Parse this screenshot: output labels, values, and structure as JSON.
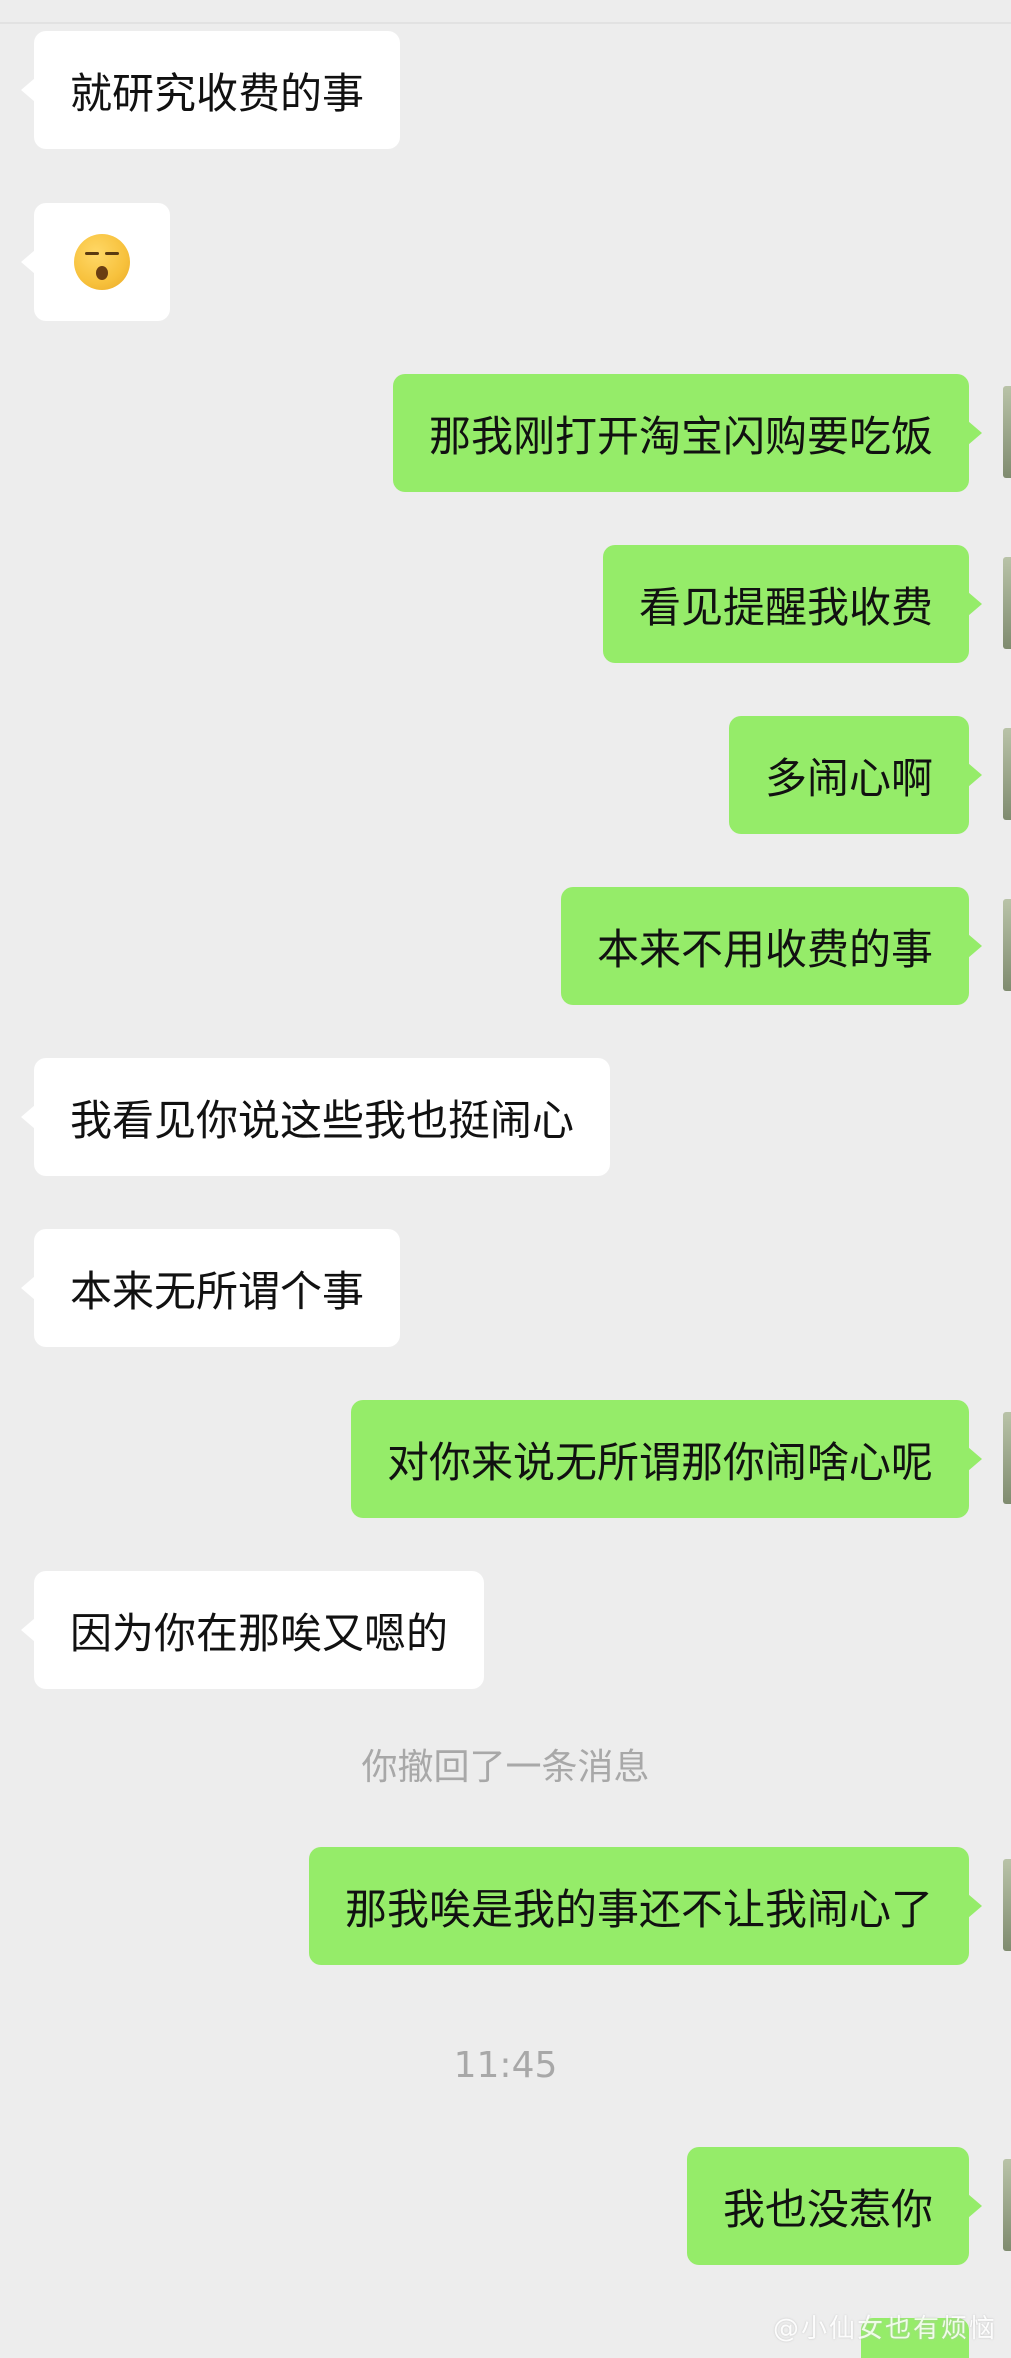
{
  "messages": [
    {
      "side": "left",
      "text": "就研究收费的事"
    },
    {
      "side": "left",
      "emoji": "weary-face-emoji"
    },
    {
      "side": "right",
      "text": "那我刚打开淘宝闪购要吃饭"
    },
    {
      "side": "right",
      "text": "看见提醒我收费"
    },
    {
      "side": "right",
      "text": "多闹心啊"
    },
    {
      "side": "right",
      "text": "本来不用收费的事"
    },
    {
      "side": "left",
      "text": "我看见你说这些我也挺闹心"
    },
    {
      "side": "left",
      "text": "本来无所谓个事"
    },
    {
      "side": "right",
      "text": "对你来说无所谓那你闹啥心呢"
    },
    {
      "side": "left",
      "text": "因为你在那唉又嗯的"
    },
    {
      "side": "right",
      "text": "那我唉是我的事还不让我闹心了"
    },
    {
      "side": "right",
      "text": "我也没惹你"
    }
  ],
  "system_notice": "你撤回了一条消息",
  "timestamp": "11:45",
  "watermark": "@小仙女也有烦恼",
  "colors": {
    "background": "#ededed",
    "incoming_bubble": "#ffffff",
    "outgoing_bubble": "#95ec69",
    "meta_text": "#a8a8a8"
  }
}
